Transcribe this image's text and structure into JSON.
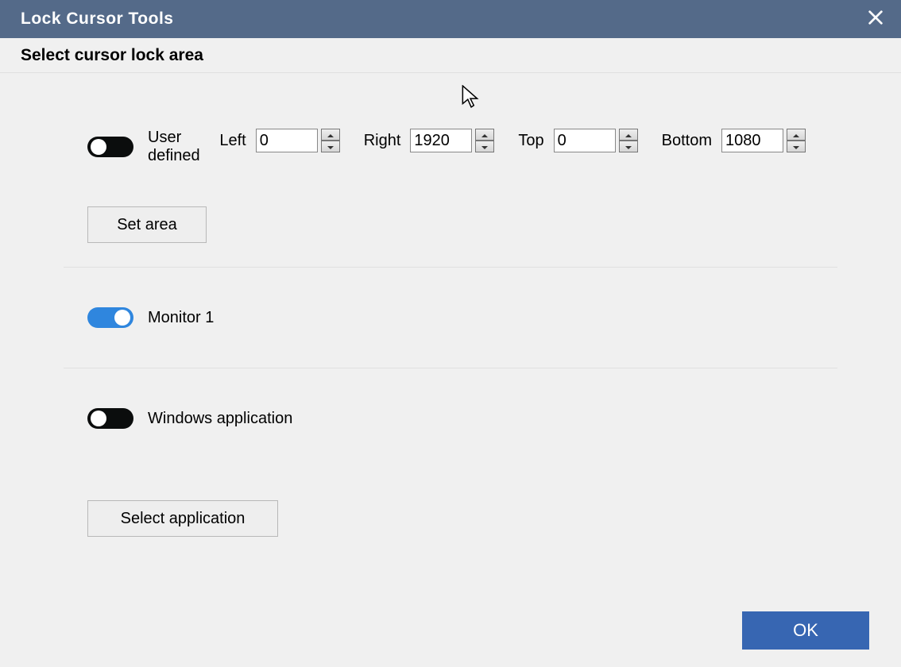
{
  "titlebar": {
    "title": "Lock Cursor Tools"
  },
  "subheader": {
    "text": "Select cursor lock area"
  },
  "section_user_defined": {
    "toggle_label": "User defined",
    "toggle_on": false,
    "set_area_btn": "Set area",
    "coords": {
      "left_label": "Left",
      "left_value": "0",
      "right_label": "Right",
      "right_value": "1920",
      "top_label": "Top",
      "top_value": "0",
      "bottom_label": "Bottom",
      "bottom_value": "1080"
    }
  },
  "section_monitor": {
    "toggle_label": "Monitor 1",
    "toggle_on": true
  },
  "section_app": {
    "toggle_label": "Windows application",
    "toggle_on": false,
    "select_app_btn": "Select application"
  },
  "ok_button": "OK"
}
